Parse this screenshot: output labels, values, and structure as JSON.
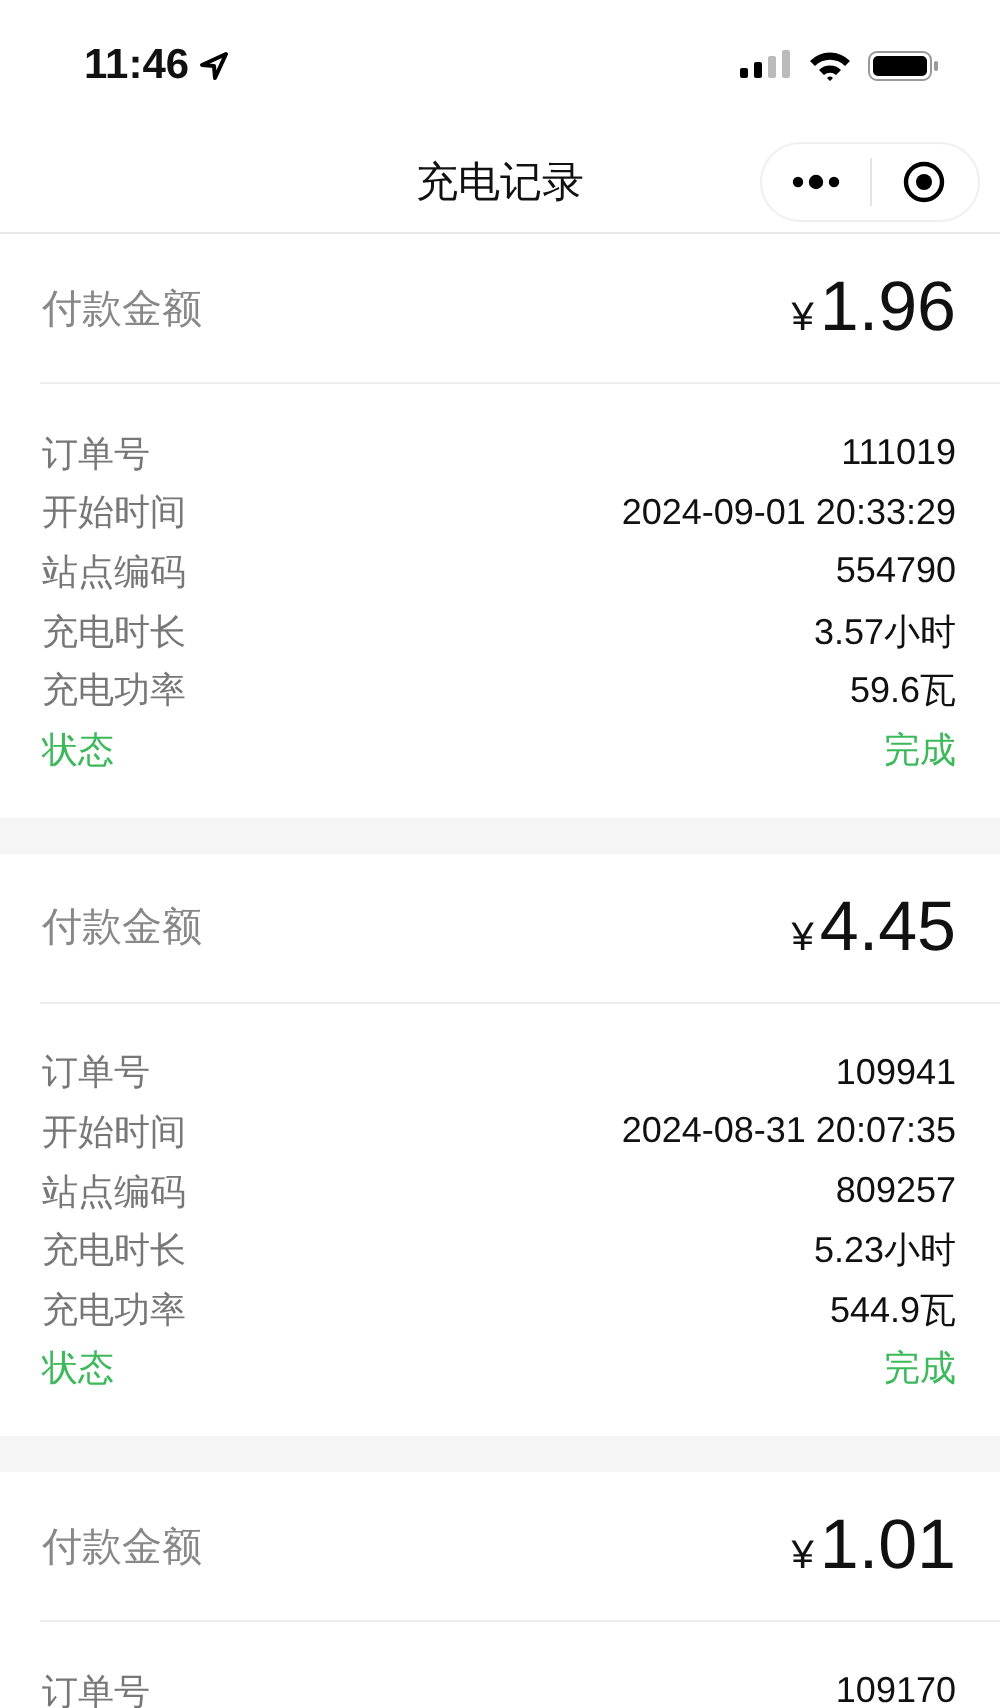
{
  "status_bar": {
    "time": "11:46"
  },
  "nav_bar": {
    "title": "充电记录"
  },
  "records": [
    {
      "amount_label": "付款金额",
      "currency": "¥",
      "amount": "1.96",
      "rows": [
        {
          "kind": "field",
          "label": "订单号",
          "value": "111019"
        },
        {
          "kind": "field",
          "label": "开始时间",
          "value": "2024-09-01 20:33:29"
        },
        {
          "kind": "field",
          "label": "站点编码",
          "value": "554790"
        },
        {
          "kind": "field",
          "label": "充电时长",
          "value": "3.57小时"
        },
        {
          "kind": "field",
          "label": "充电功率",
          "value": "59.6瓦"
        },
        {
          "kind": "status",
          "label": "状态",
          "value": "完成"
        }
      ]
    },
    {
      "amount_label": "付款金额",
      "currency": "¥",
      "amount": "4.45",
      "rows": [
        {
          "kind": "field",
          "label": "订单号",
          "value": "109941"
        },
        {
          "kind": "field",
          "label": "开始时间",
          "value": "2024-08-31 20:07:35"
        },
        {
          "kind": "field",
          "label": "站点编码",
          "value": "809257"
        },
        {
          "kind": "field",
          "label": "充电时长",
          "value": "5.23小时"
        },
        {
          "kind": "field",
          "label": "充电功率",
          "value": "544.9瓦"
        },
        {
          "kind": "status",
          "label": "状态",
          "value": "完成"
        }
      ]
    },
    {
      "amount_label": "付款金额",
      "currency": "¥",
      "amount": "1.01",
      "rows": [
        {
          "kind": "field",
          "label": "订单号",
          "value": "109170"
        }
      ]
    }
  ]
}
